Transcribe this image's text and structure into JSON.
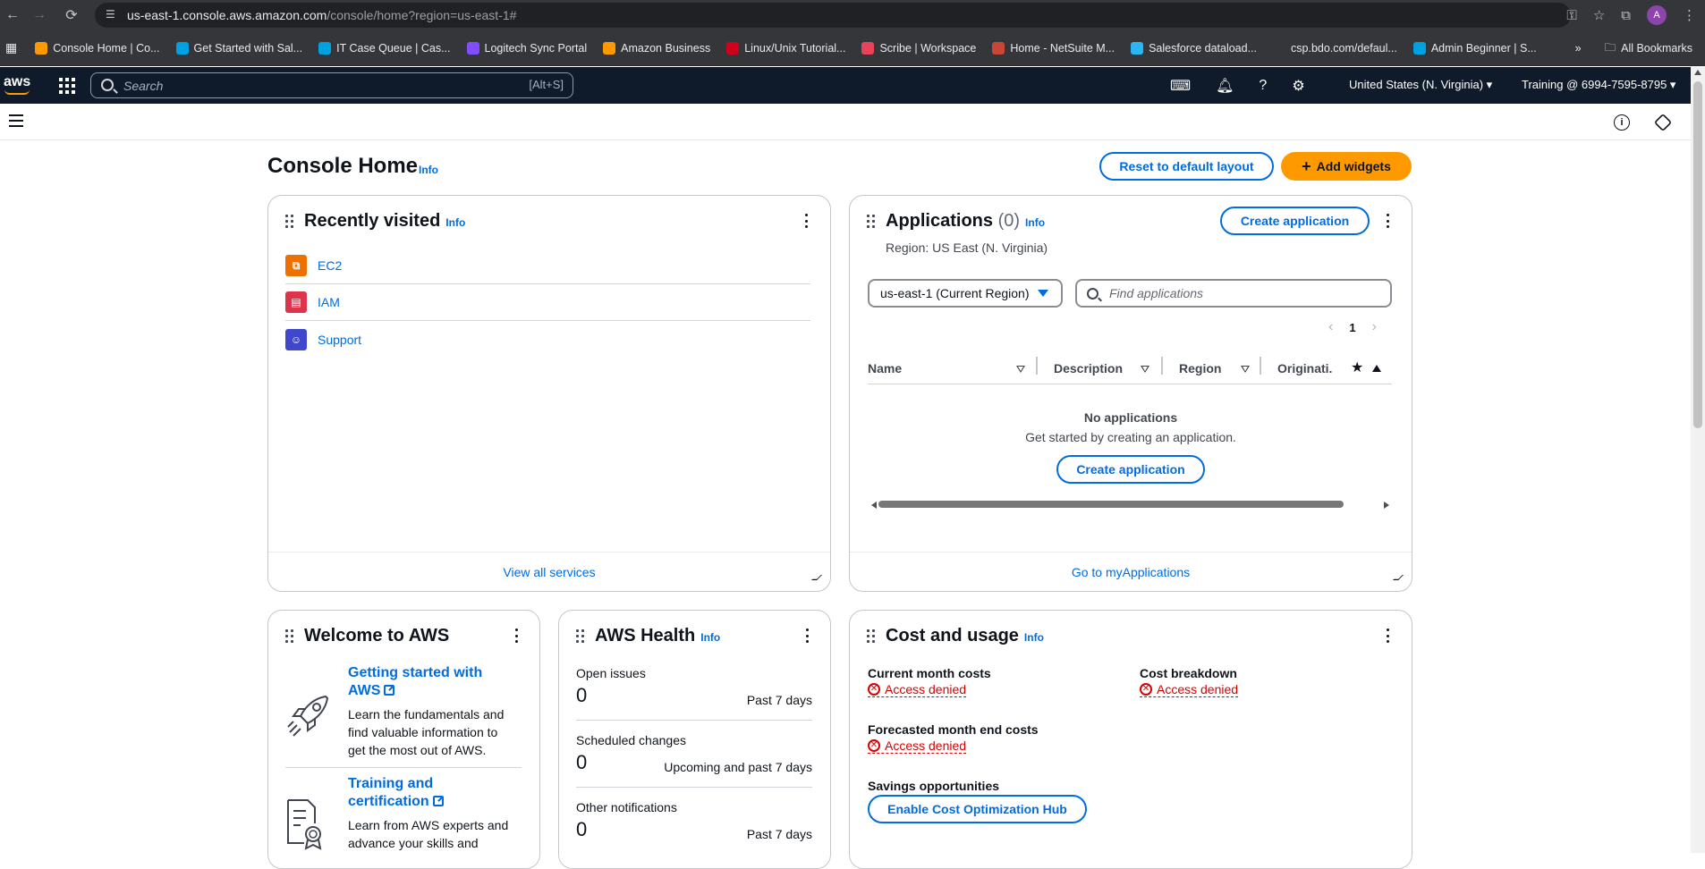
{
  "browser": {
    "url_host": "us-east-1.console.aws.amazon.com",
    "url_path": "/console/home?region=us-east-1#",
    "avatar_letter": "A",
    "bookmarks": [
      {
        "label": "Console Home | Co...",
        "color": "#ff9900"
      },
      {
        "label": "Get Started with Sal...",
        "color": "#00a1e0"
      },
      {
        "label": "IT Case Queue | Cas...",
        "color": "#00a1e0"
      },
      {
        "label": "Logitech Sync Portal",
        "color": "#814eff"
      },
      {
        "label": "Amazon Business",
        "color": "#ff9900"
      },
      {
        "label": "Linux/Unix Tutorial...",
        "color": "#d0021b"
      },
      {
        "label": "Scribe | Workspace",
        "color": "#e8435a"
      },
      {
        "label": "Home - NetSuite M...",
        "color": "#c74634"
      },
      {
        "label": "Salesforce dataload...",
        "color": "#2bb5f2"
      },
      {
        "label": "csp.bdo.com/defaul...",
        "color": "#35363a"
      },
      {
        "label": "Admin Beginner | S...",
        "color": "#00a1e0"
      }
    ],
    "all_bookmarks": "All Bookmarks"
  },
  "aws_nav": {
    "search_placeholder": "Search",
    "search_shortcut": "[Alt+S]",
    "region": "United States (N. Virginia) ▾",
    "account": "Training @ 6994-7595-8795 ▾"
  },
  "page": {
    "title": "Console Home",
    "info": "Info",
    "reset_button": "Reset to default layout",
    "add_widgets_button": "Add widgets"
  },
  "recently_visited": {
    "title": "Recently visited",
    "info": "Info",
    "items": [
      {
        "label": "EC2",
        "color": "#ed7100",
        "icon": "ec2-icon"
      },
      {
        "label": "IAM",
        "color": "#dd344c",
        "icon": "iam-icon"
      },
      {
        "label": "Support",
        "color": "#3f48cc",
        "icon": "support-icon"
      }
    ],
    "footer": "View all services"
  },
  "applications": {
    "title": "Applications",
    "count": "(0)",
    "info": "Info",
    "create_button": "Create application",
    "region_label": "Region: US East (N. Virginia)",
    "region_select": "us-east-1 (Current Region)",
    "find_placeholder": "Find applications",
    "page_number": "1",
    "columns": [
      "Name",
      "Description",
      "Region",
      "Originati..."
    ],
    "empty_title": "No applications",
    "empty_desc": "Get started by creating an application.",
    "empty_create_button": "Create application",
    "footer": "Go to myApplications"
  },
  "welcome": {
    "title": "Welcome to AWS",
    "items": [
      {
        "title": "Getting started with AWS",
        "desc": "Learn the fundamentals and find valuable information to get the most out of AWS."
      },
      {
        "title": "Training and certification",
        "desc": "Learn from AWS experts and advance your skills and"
      }
    ]
  },
  "health": {
    "title": "AWS Health",
    "info": "Info",
    "rows": [
      {
        "label": "Open issues",
        "value": "0",
        "period": "Past 7 days"
      },
      {
        "label": "Scheduled changes",
        "value": "0",
        "period": "Upcoming and past 7 days"
      },
      {
        "label": "Other notifications",
        "value": "0",
        "period": "Past 7 days"
      }
    ]
  },
  "cost": {
    "title": "Cost and usage",
    "info": "Info",
    "current_label": "Current month costs",
    "current_value": "Access denied",
    "breakdown_label": "Cost breakdown",
    "breakdown_value": "Access denied",
    "forecast_label": "Forecasted month end costs",
    "forecast_value": "Access denied",
    "savings_label": "Savings opportunities",
    "savings_button": "Enable Cost Optimization Hub"
  }
}
